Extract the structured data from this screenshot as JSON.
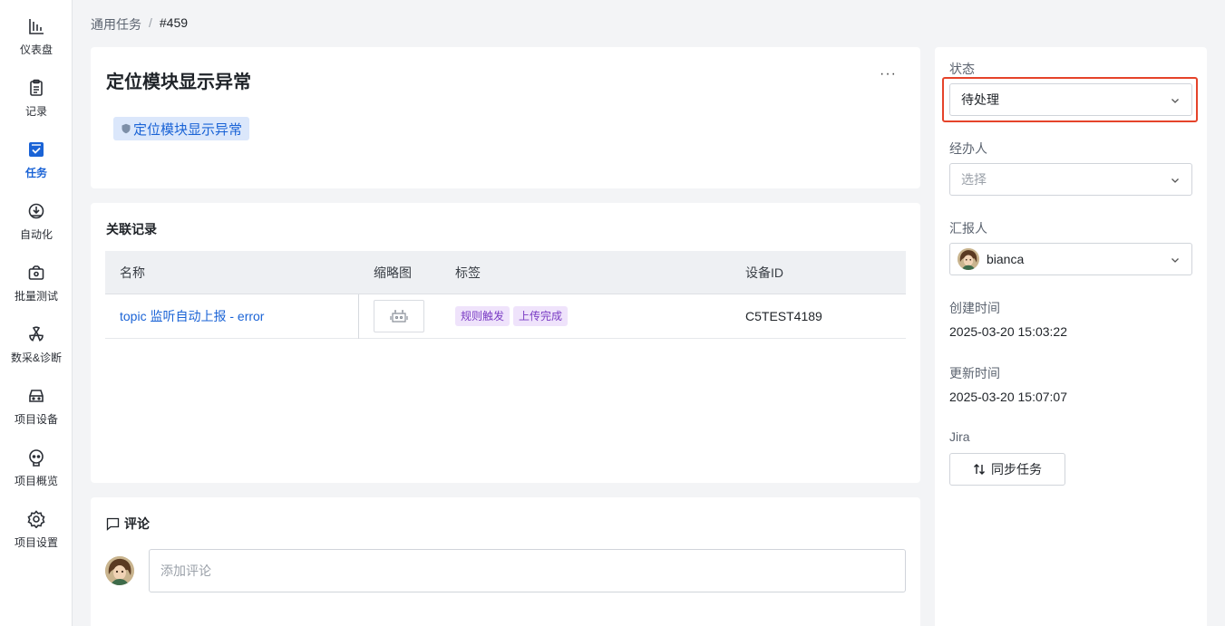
{
  "sidebar": {
    "items": [
      {
        "label": "仪表盘",
        "icon": "bar-chart-icon"
      },
      {
        "label": "记录",
        "icon": "clipboard-icon"
      },
      {
        "label": "任务",
        "icon": "task-check-icon",
        "active": true
      },
      {
        "label": "自动化",
        "icon": "automation-icon"
      },
      {
        "label": "批量测试",
        "icon": "batch-test-icon"
      },
      {
        "label": "数采&诊断",
        "icon": "radiation-icon"
      },
      {
        "label": "项目设备",
        "icon": "device-icon"
      },
      {
        "label": "项目概览",
        "icon": "robot-head-icon"
      },
      {
        "label": "项目设置",
        "icon": "gear-icon"
      }
    ]
  },
  "breadcrumb": {
    "parent": "通用任务",
    "separator": "/",
    "current": "#459"
  },
  "task": {
    "title": "定位模块显示异常",
    "more": "···",
    "tag": "定位模块显示异常"
  },
  "records": {
    "heading": "关联记录",
    "columns": [
      "名称",
      "缩略图",
      "标签",
      "设备ID"
    ],
    "rows": [
      {
        "name": "topic 监听自动上报 - error",
        "tags": [
          "规则触发",
          "上传完成"
        ],
        "device_id": "C5TEST4189"
      }
    ]
  },
  "comment": {
    "heading": "评论",
    "placeholder": "添加评论"
  },
  "panel": {
    "status_label": "状态",
    "status_value": "待处理",
    "assignee_label": "经办人",
    "assignee_placeholder": "选择",
    "reporter_label": "汇报人",
    "reporter_value": "bianca",
    "created_label": "创建时间",
    "created_value": "2025-03-20 15:03:22",
    "updated_label": "更新时间",
    "updated_value": "2025-03-20 15:07:07",
    "jira_label": "Jira",
    "sync_label": "同步任务"
  },
  "colors": {
    "accent": "#1a63d6",
    "highlight": "#e5432a",
    "tag_bg": "#efe3fb",
    "tag_fg": "#7a3cc4"
  }
}
